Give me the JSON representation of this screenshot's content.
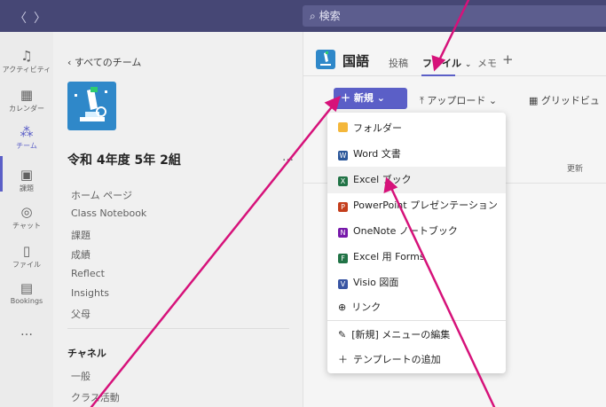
{
  "search": {
    "placeholder": "検索"
  },
  "rail": {
    "items": [
      {
        "label": "アクティビティ",
        "icon": "bell-icon"
      },
      {
        "label": "カレンダー",
        "icon": "calendar-icon"
      },
      {
        "label": "チーム",
        "icon": "teams-icon"
      },
      {
        "label": "課題",
        "icon": "assignments-icon"
      },
      {
        "label": "チャット",
        "icon": "chat-icon"
      },
      {
        "label": "ファイル",
        "icon": "file-icon"
      },
      {
        "label": "Bookings",
        "icon": "bookings-icon"
      },
      {
        "label": "…",
        "icon": "more-icon"
      }
    ]
  },
  "teampane": {
    "back_label": "すべてのチーム",
    "team_name": "令和 4年度 5年 2組",
    "links": [
      "ホーム ページ",
      "Class Notebook",
      "課題",
      "成績",
      "Reflect",
      "Insights",
      "父母"
    ],
    "channels_heading": "チャネル",
    "channels": [
      "一般",
      "クラス活動"
    ]
  },
  "main": {
    "channel_name": "国語",
    "tabs": {
      "posts": "投稿",
      "files": "ファイル",
      "notes": "メモ",
      "add": "+"
    },
    "toolbar": {
      "new_label": "新規",
      "upload_label": "アップロード",
      "gridview_label": "グリッドビュ"
    },
    "update_label": "更新"
  },
  "new_menu": {
    "items": [
      {
        "label": "フォルダー",
        "icon": "folder-icon",
        "color": "#f4b73b"
      },
      {
        "label": "Word 文書",
        "icon": "word-icon",
        "color": "#2b579a"
      },
      {
        "label": "Excel ブック",
        "icon": "excel-icon",
        "color": "#217346"
      },
      {
        "label": "PowerPoint プレゼンテーション",
        "icon": "powerpoint-icon",
        "color": "#c43e1c"
      },
      {
        "label": "OneNote ノートブック",
        "icon": "onenote-icon",
        "color": "#7719aa"
      },
      {
        "label": "Excel 用 Forms",
        "icon": "forms-icon",
        "color": "#217346"
      },
      {
        "label": "Visio 図面",
        "icon": "visio-icon",
        "color": "#3955a3"
      },
      {
        "label": "リンク",
        "icon": "globe-icon",
        "color": "#424242"
      },
      {
        "label": "[新規] メニューの編集",
        "icon": "pencil-icon",
        "color": "#424242"
      },
      {
        "label": "テンプレートの追加",
        "icon": "plus-icon",
        "color": "#424242"
      }
    ]
  },
  "colors": {
    "accent": "#5b5fc7",
    "topbar": "#464775",
    "arrow": "#d6127a"
  }
}
